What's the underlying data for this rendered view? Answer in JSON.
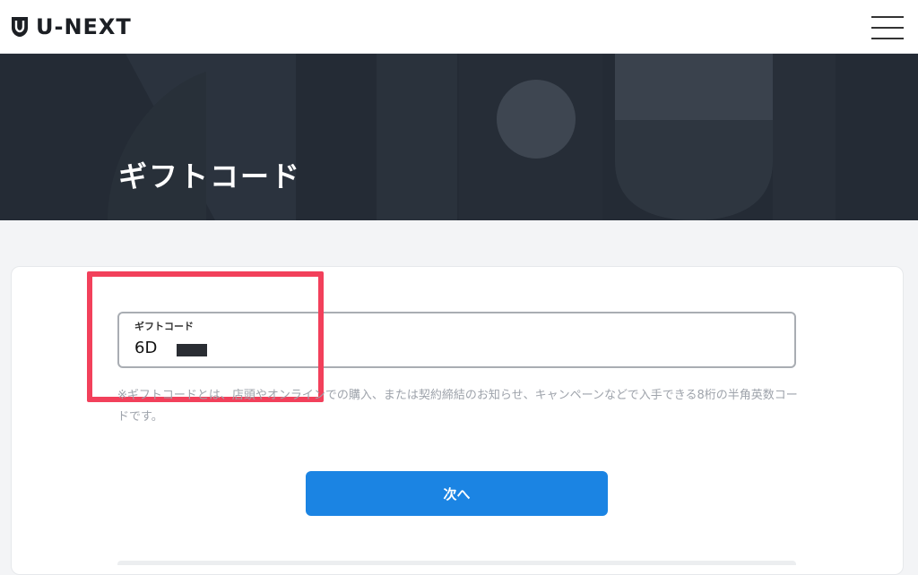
{
  "header": {
    "logo_text": "U-NEXT",
    "logo_icon": "shield-logo-icon",
    "menu_icon": "hamburger-menu-icon"
  },
  "hero": {
    "title": "ギフトコード"
  },
  "form": {
    "field_label": "ギフトコード",
    "field_value": "6D",
    "note": "※ギフトコードとは、店頭やオンラインでの購入、または契約締結のお知らせ、キャンペーンなどで入手できる8桁の半角英数コードです。",
    "next_label": "次へ"
  },
  "colors": {
    "accent": "#1b84e3",
    "highlight": "#f2405b",
    "hero_bg": "#242b35"
  }
}
